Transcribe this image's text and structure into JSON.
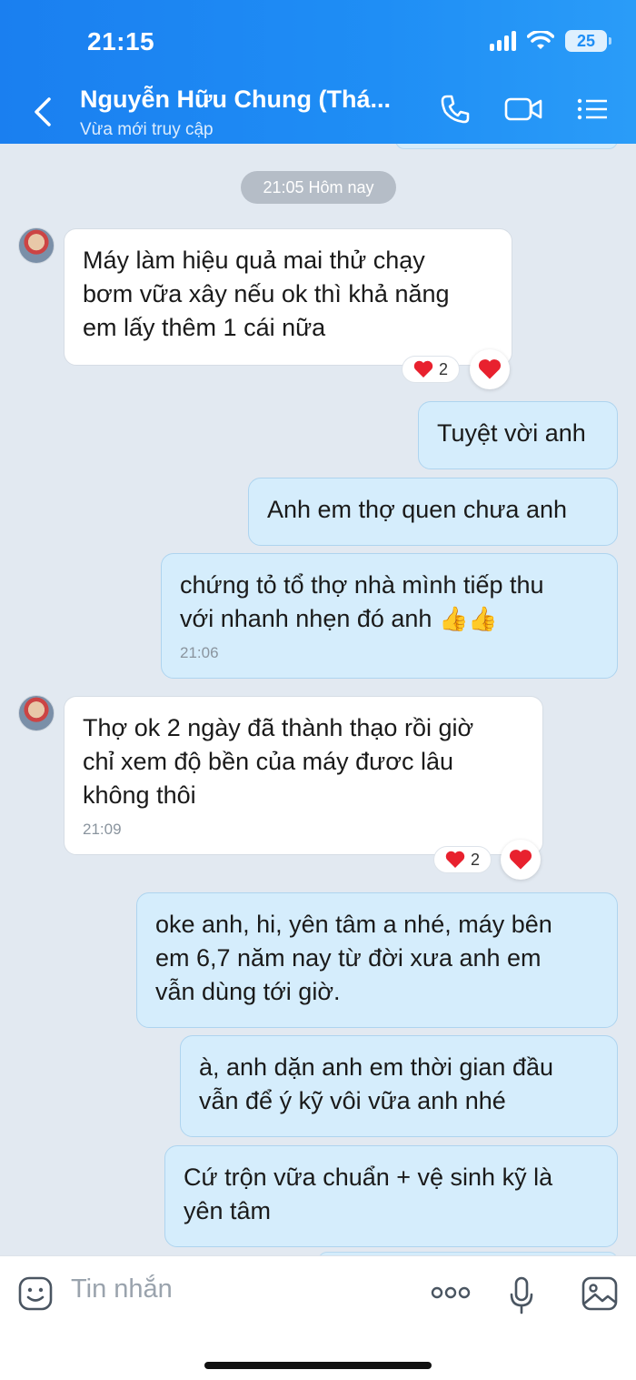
{
  "status_bar": {
    "time": "21:15",
    "battery": "25"
  },
  "header": {
    "title": "Nguyễn Hữu Chung (Thá...",
    "subtitle": "Vừa mới truy cập"
  },
  "chat": {
    "time_divider": "21:05 Hôm nay",
    "messages": [
      {
        "dir": "in",
        "lines": [
          "Máy làm hiệu quả   mai thử chạy",
          "bơm vữa xây nếu ok thì khả năng",
          "em lấy thêm 1 cái nữa"
        ],
        "reaction_count": "2"
      },
      {
        "dir": "out",
        "lines": [
          "Tuyệt vời anh"
        ]
      },
      {
        "dir": "out",
        "lines": [
          "Anh em thợ quen chưa anh"
        ]
      },
      {
        "dir": "out",
        "lines": [
          "chứng tỏ tổ thợ nhà mình tiếp thu",
          "với nhanh nhẹn đó anh"
        ],
        "emoji": "👍👍",
        "time": "21:06"
      },
      {
        "dir": "in",
        "lines": [
          "Thợ ok 2 ngày đã thành thạo rồi giờ",
          "chỉ xem độ bền của máy đươc lâu",
          "không thôi"
        ],
        "time": "21:09",
        "reaction_count": "2"
      },
      {
        "dir": "out",
        "lines": [
          "oke anh, hi, yên tâm a nhé, máy bên",
          "em 6,7 năm nay từ đời xưa anh em",
          "vẫn dùng tới giờ."
        ]
      },
      {
        "dir": "out",
        "lines": [
          "à, anh dặn anh em thời gian đầu",
          "vẫn để ý kỹ vôi vữa anh nhé"
        ]
      },
      {
        "dir": "out",
        "lines": [
          "Cứ trộn vữa chuẩn + vệ sinh kỹ là",
          "yên tâm"
        ]
      }
    ]
  },
  "input": {
    "placeholder": "Tin nhắn"
  },
  "colors": {
    "header": "#1f8ef5",
    "outgoing_bubble": "#d5edfc",
    "incoming_bubble": "#ffffff",
    "heart": "#e8212e"
  }
}
